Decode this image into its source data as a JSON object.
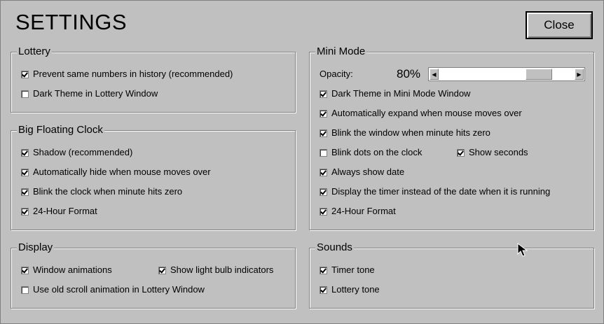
{
  "title": "SETTINGS",
  "close_label": "Close",
  "lottery": {
    "title": "Lottery",
    "prevent_same": {
      "label": "Prevent same numbers in history (recommended)",
      "checked": true
    },
    "dark_theme": {
      "label": "Dark Theme in Lottery Window",
      "checked": false
    }
  },
  "clock": {
    "title": "Big Floating Clock",
    "shadow": {
      "label": "Shadow (recommended)",
      "checked": true
    },
    "auto_hide": {
      "label": "Automatically hide when mouse moves over",
      "checked": true
    },
    "blink": {
      "label": "Blink the clock when minute hits zero",
      "checked": true
    },
    "hour24": {
      "label": "24-Hour Format",
      "checked": true
    }
  },
  "display": {
    "title": "Display",
    "window_animations": {
      "label": "Window animations",
      "checked": true
    },
    "light_bulb": {
      "label": "Show light bulb indicators",
      "checked": true
    },
    "old_scroll": {
      "label": "Use old scroll animation in Lottery Window",
      "checked": false
    }
  },
  "mini": {
    "title": "Mini Mode",
    "opacity_label": "Opacity:",
    "opacity_value": "80%",
    "opacity_fraction": 0.8,
    "dark_theme": {
      "label": "Dark Theme in Mini Mode Window",
      "checked": true
    },
    "auto_expand": {
      "label": "Automatically expand when mouse moves over",
      "checked": true
    },
    "blink_window": {
      "label": "Blink the window when minute hits zero",
      "checked": true
    },
    "blink_dots": {
      "label": "Blink dots on the clock",
      "checked": false
    },
    "show_seconds": {
      "label": "Show seconds",
      "checked": true
    },
    "always_date": {
      "label": "Always show date",
      "checked": true
    },
    "timer_instead": {
      "label": "Display the timer instead of the date when it is running",
      "checked": true
    },
    "hour24": {
      "label": "24-Hour Format",
      "checked": true
    }
  },
  "sounds": {
    "title": "Sounds",
    "timer_tone": {
      "label": "Timer tone",
      "checked": true
    },
    "lottery_tone": {
      "label": "Lottery tone",
      "checked": true
    }
  }
}
